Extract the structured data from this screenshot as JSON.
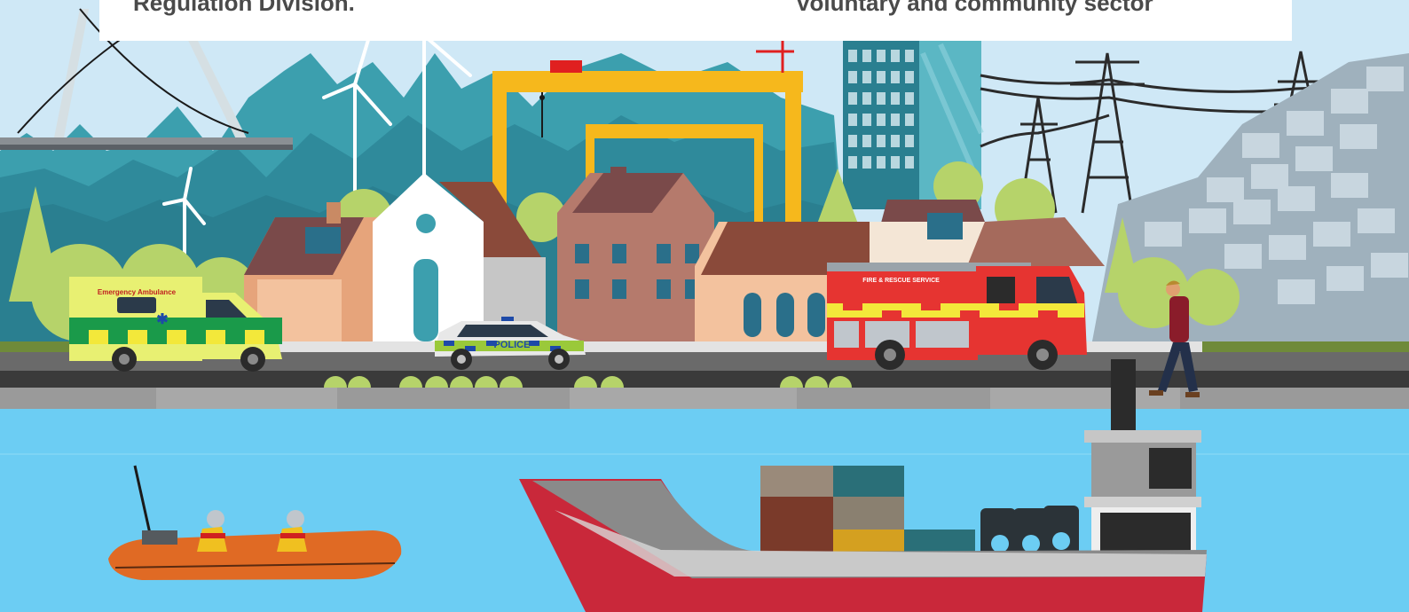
{
  "banner": {
    "left_text": "Regulation Division.",
    "right_text": "voluntary and community sector"
  },
  "vehicles": {
    "ambulance_label": "Emergency Ambulance",
    "police_label": "POLICE",
    "fire_label": "FIRE & RESCUE SERVICE"
  },
  "icons": [
    "bridge-icon",
    "wind-turbine-icon",
    "gantry-crane-icon",
    "pylon-icon",
    "person-icon",
    "ship-icon",
    "lifeboat-icon"
  ],
  "colors": {
    "sky": "#cfe8f6",
    "water": "#6ccdf3",
    "crane": "#f6b81c",
    "fire_engine": "#e63431",
    "hull": "#c9283a"
  }
}
